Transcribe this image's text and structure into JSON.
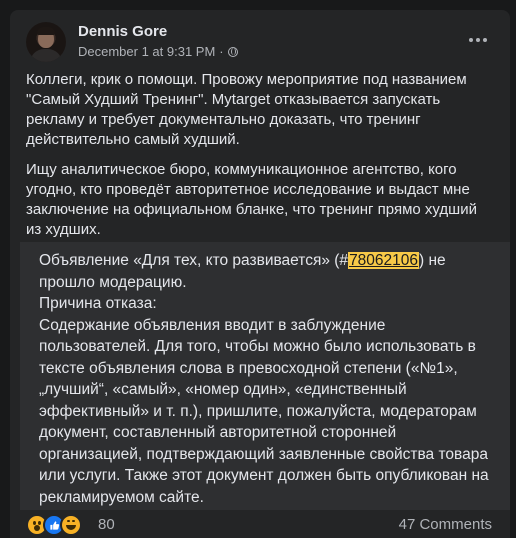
{
  "post": {
    "author": "Dennis Gore",
    "timestamp": "December 1 at 9:31 PM",
    "audience_icon": "globe-icon",
    "paragraphs": [
      "Коллеги, крик о помощи. Провожу мероприятие под названием \"Самый Худший Тренинг\". Mytarget отказывается запускать рекламу и требует документально доказать, что тренинг действительно самый худший.",
      "Ищу аналитическое бюро, коммуникационное агентство, кого угодно, кто проведёт авторитетное исследование и выдаст мне заключение на официальном бланке, что тренинг прямо худший из худших."
    ]
  },
  "shared": {
    "line1_prefix": "Объявление «Для тех, кто развивается» (#",
    "ad_id": "78062106",
    "line1_suffix": ") не",
    "line2": "прошло модерацию.",
    "line3": "Причина отказа:",
    "body_lines": [
      "Содержание объявления вводит в заблуждение",
      "пользователей. Для того, чтобы можно было использовать в",
      "тексте объявления слова в превосходной степени («№1»,",
      "„лучший“, «самый», «номер один», «единственный",
      "эффективный» и т. п.), пришлите, пожалуйста, модераторам",
      "документ, составленный авторитетной сторонней",
      "организацией, подтверждающий заявленные свойства товара",
      "или услуги. Также этот документ должен быть опубликован на",
      "рекламируемом сайте."
    ],
    "highlight_color": "#f7c948"
  },
  "footer": {
    "reactions": [
      "wow-icon",
      "like-icon",
      "haha-icon"
    ],
    "reaction_count": "80",
    "comments": "47 Comments"
  }
}
